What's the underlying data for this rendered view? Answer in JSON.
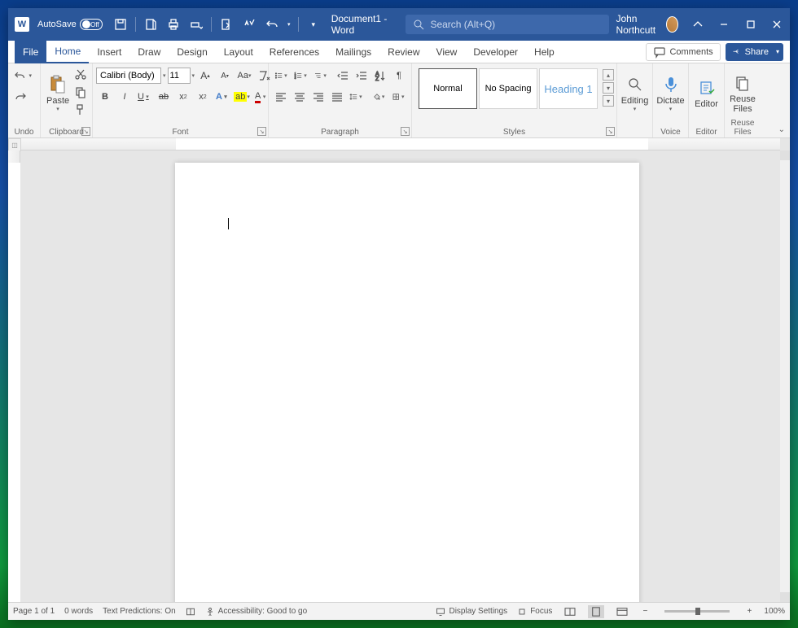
{
  "titlebar": {
    "autosave_label": "AutoSave",
    "autosave_state": "Off",
    "document_title": "Document1 - Word",
    "search_placeholder": "Search (Alt+Q)",
    "user_name": "John Northcutt"
  },
  "tabs": {
    "file": "File",
    "items": [
      "Home",
      "Insert",
      "Draw",
      "Design",
      "Layout",
      "References",
      "Mailings",
      "Review",
      "View",
      "Developer",
      "Help"
    ],
    "active": "Home",
    "comments": "Comments",
    "share": "Share"
  },
  "ribbon": {
    "undo_label": "Undo",
    "clipboard": {
      "paste": "Paste",
      "label": "Clipboard"
    },
    "font": {
      "name": "Calibri (Body)",
      "size": "11",
      "label": "Font"
    },
    "paragraph": {
      "label": "Paragraph"
    },
    "styles": {
      "items": [
        "Normal",
        "No Spacing",
        "Heading 1"
      ],
      "label": "Styles"
    },
    "editing": {
      "label": "Editing"
    },
    "voice": {
      "dictate": "Dictate",
      "label": "Voice"
    },
    "editor": {
      "btn": "Editor",
      "label": "Editor"
    },
    "reuse": {
      "line1": "Reuse",
      "line2": "Files",
      "label": "Reuse Files"
    }
  },
  "status": {
    "page": "Page 1 of 1",
    "words": "0 words",
    "predictions": "Text Predictions: On",
    "accessibility": "Accessibility: Good to go",
    "display_settings": "Display Settings",
    "focus": "Focus",
    "zoom": "100%"
  }
}
